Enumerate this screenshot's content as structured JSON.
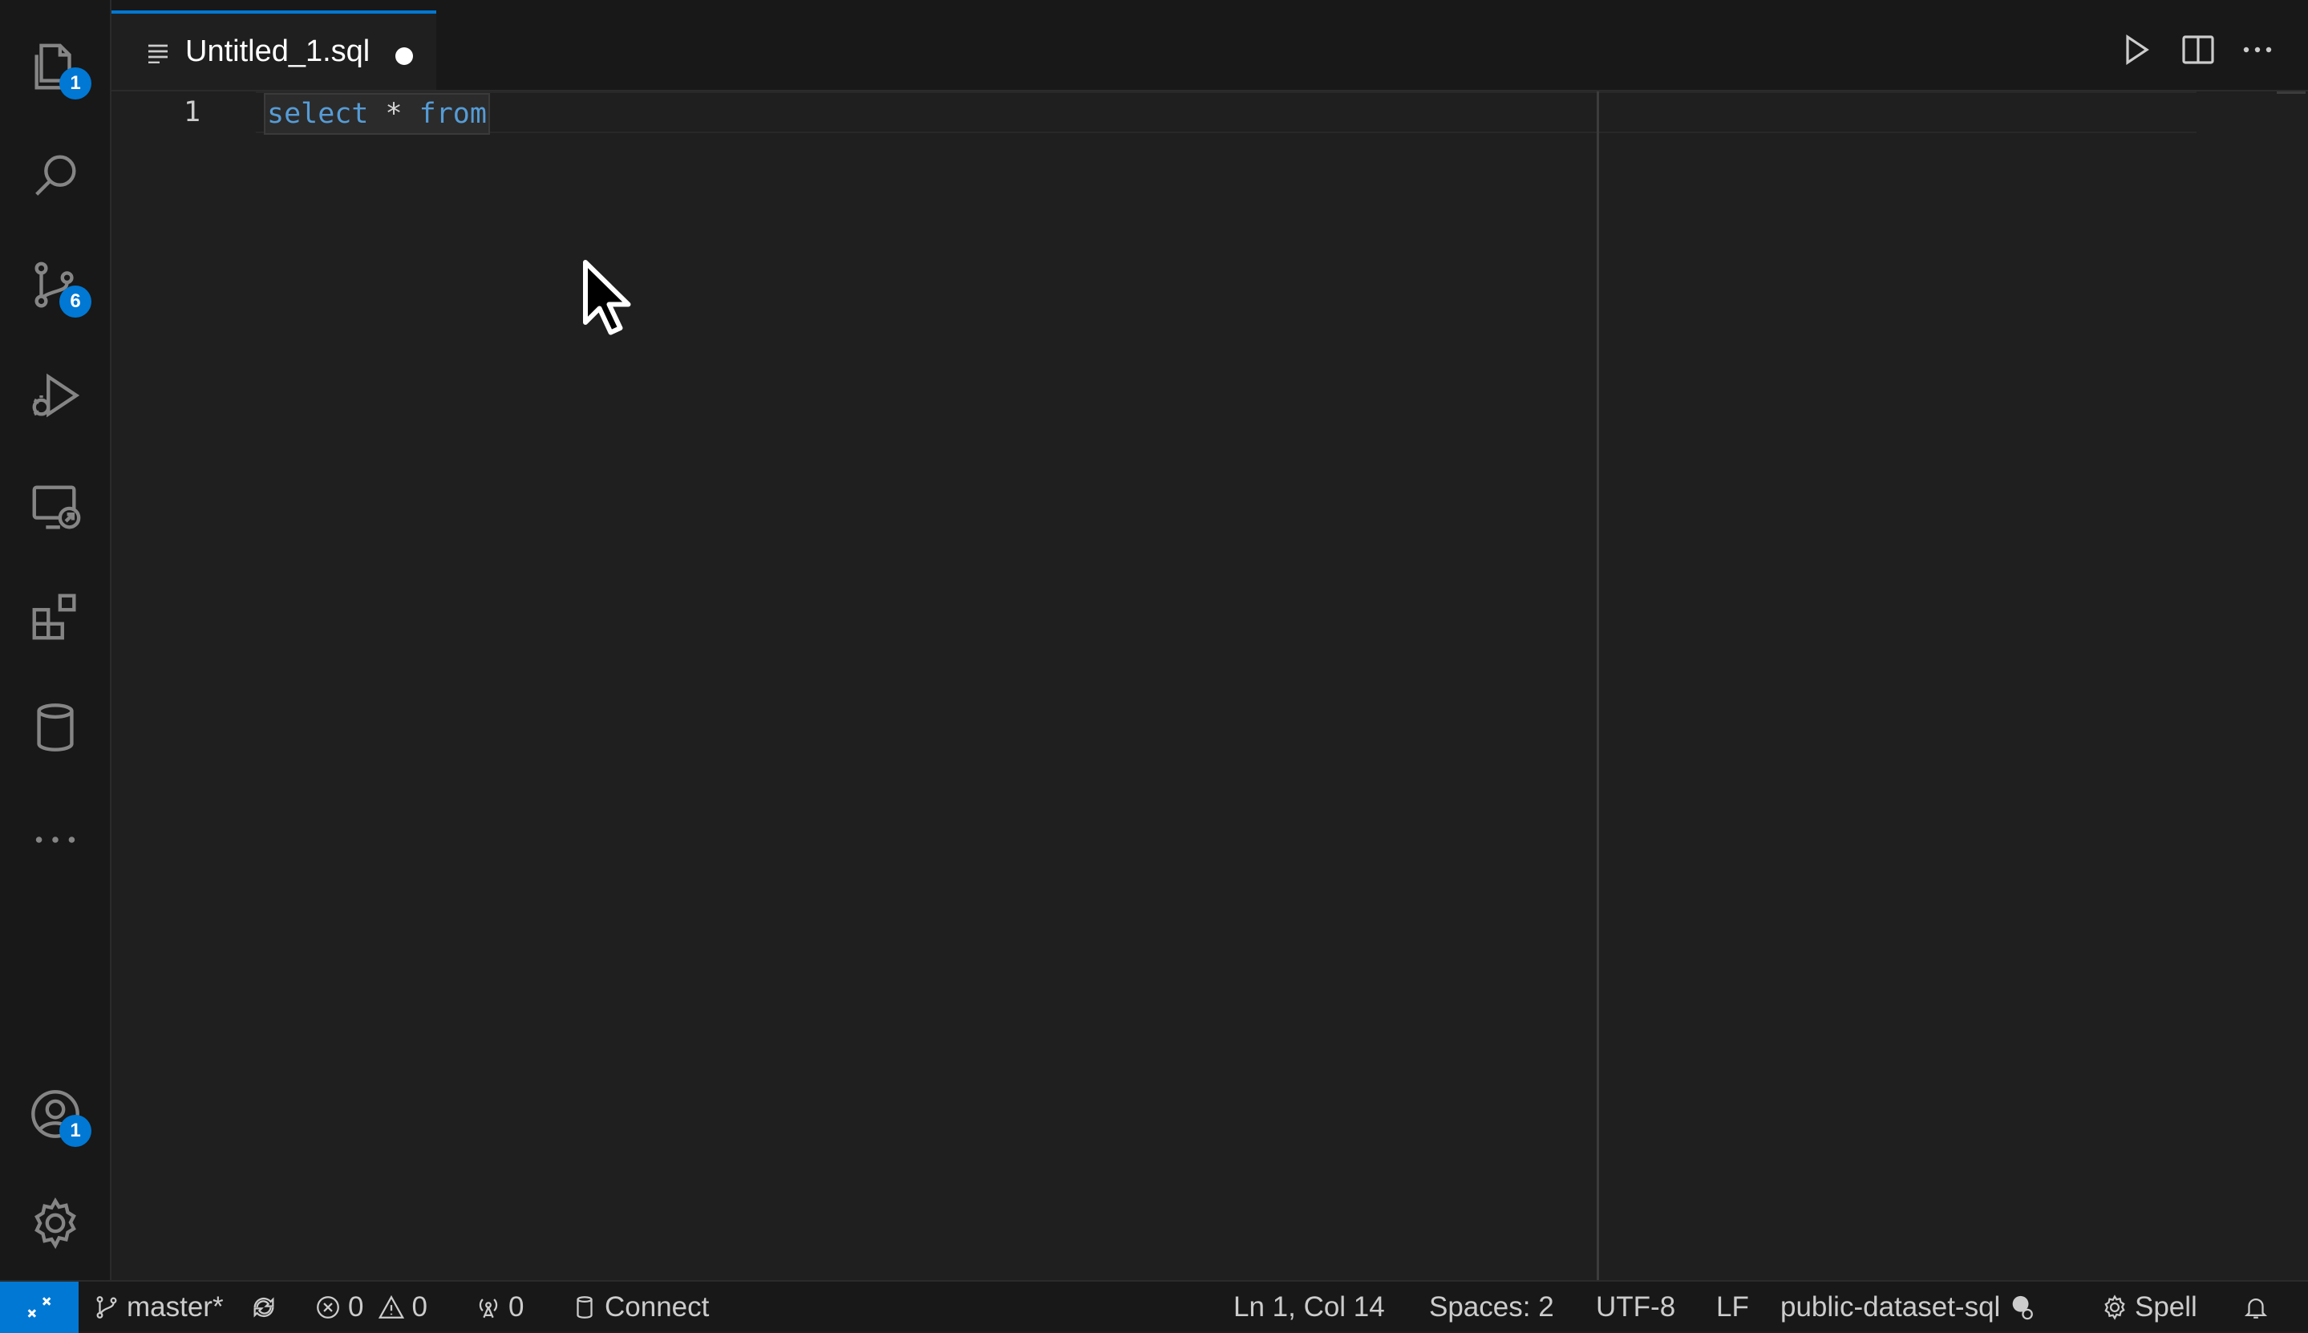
{
  "editor_tab": {
    "title": "Untitled_1.sql",
    "dirty": true
  },
  "activity_bar": {
    "items": [
      {
        "name": "explorer",
        "icon": "files-icon",
        "badge": "1"
      },
      {
        "name": "search",
        "icon": "search-icon",
        "badge": ""
      },
      {
        "name": "source-control",
        "icon": "source-control-icon",
        "badge": "6"
      },
      {
        "name": "run-and-debug",
        "icon": "run-debug-icon",
        "badge": ""
      },
      {
        "name": "remote-explorer",
        "icon": "remote-explorer-icon",
        "badge": ""
      },
      {
        "name": "extensions",
        "icon": "extensions-icon",
        "badge": ""
      },
      {
        "name": "database",
        "icon": "database-icon",
        "badge": ""
      },
      {
        "name": "more",
        "icon": "ellipsis-icon",
        "badge": ""
      }
    ],
    "accounts_badge": "1"
  },
  "editor": {
    "line_numbers": [
      "1"
    ],
    "code_tokens": [
      {
        "text": "select",
        "kind": "keyword"
      },
      {
        "text": " * ",
        "kind": "operator"
      },
      {
        "text": "from",
        "kind": "keyword"
      }
    ]
  },
  "status_bar": {
    "branch": "master*",
    "errors": "0",
    "warnings": "0",
    "ports": "0",
    "connect": "Connect",
    "position": "Ln 1, Col 14",
    "spaces": "Spaces: 2",
    "encoding": "UTF-8",
    "eol": "LF",
    "workspace": "public-dataset-sql",
    "spell": "Spell"
  },
  "colors": {
    "accent": "#0078d4",
    "keyword": "#569cd6",
    "background": "#1f1f1f",
    "sidebar": "#181818"
  }
}
